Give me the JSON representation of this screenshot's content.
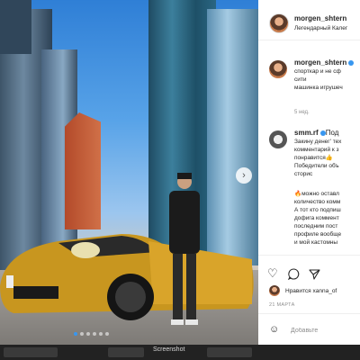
{
  "post": {
    "author": "morgen_shtern",
    "location": "Легендарный Калег",
    "caption": {
      "author": "morgen_shtern",
      "lines": [
        "спорткар и не сф",
        "сити",
        "машинка игрушеч"
      ],
      "time": "5 нед."
    },
    "comment": {
      "author": "smm.rf",
      "lines": [
        "Под",
        "Закину денег' тех",
        "комментарий к з",
        "понравится👍",
        "Победители объ",
        "сторис",
        "🔥можно оставл",
        "количество комм",
        "А тот кто подпиш",
        "дофига коммент",
        "последним пост",
        "профиле вообще",
        "и мой кастомны"
      ]
    },
    "likes_text": "Нравится xanna_of",
    "date": "21 МАРТА",
    "add_comment_placeholder": "Добавьте"
  },
  "carousel": {
    "slides": 6,
    "active": 0
  },
  "bottom_label": "Screenshot",
  "icons": [
    "heart-icon",
    "comment-icon",
    "share-icon",
    "emoji-icon",
    "verified-icon",
    "chevron-right-icon"
  ],
  "colors": {
    "accent": "#3897f0",
    "text": "#262626",
    "muted": "#8e8e8e"
  }
}
